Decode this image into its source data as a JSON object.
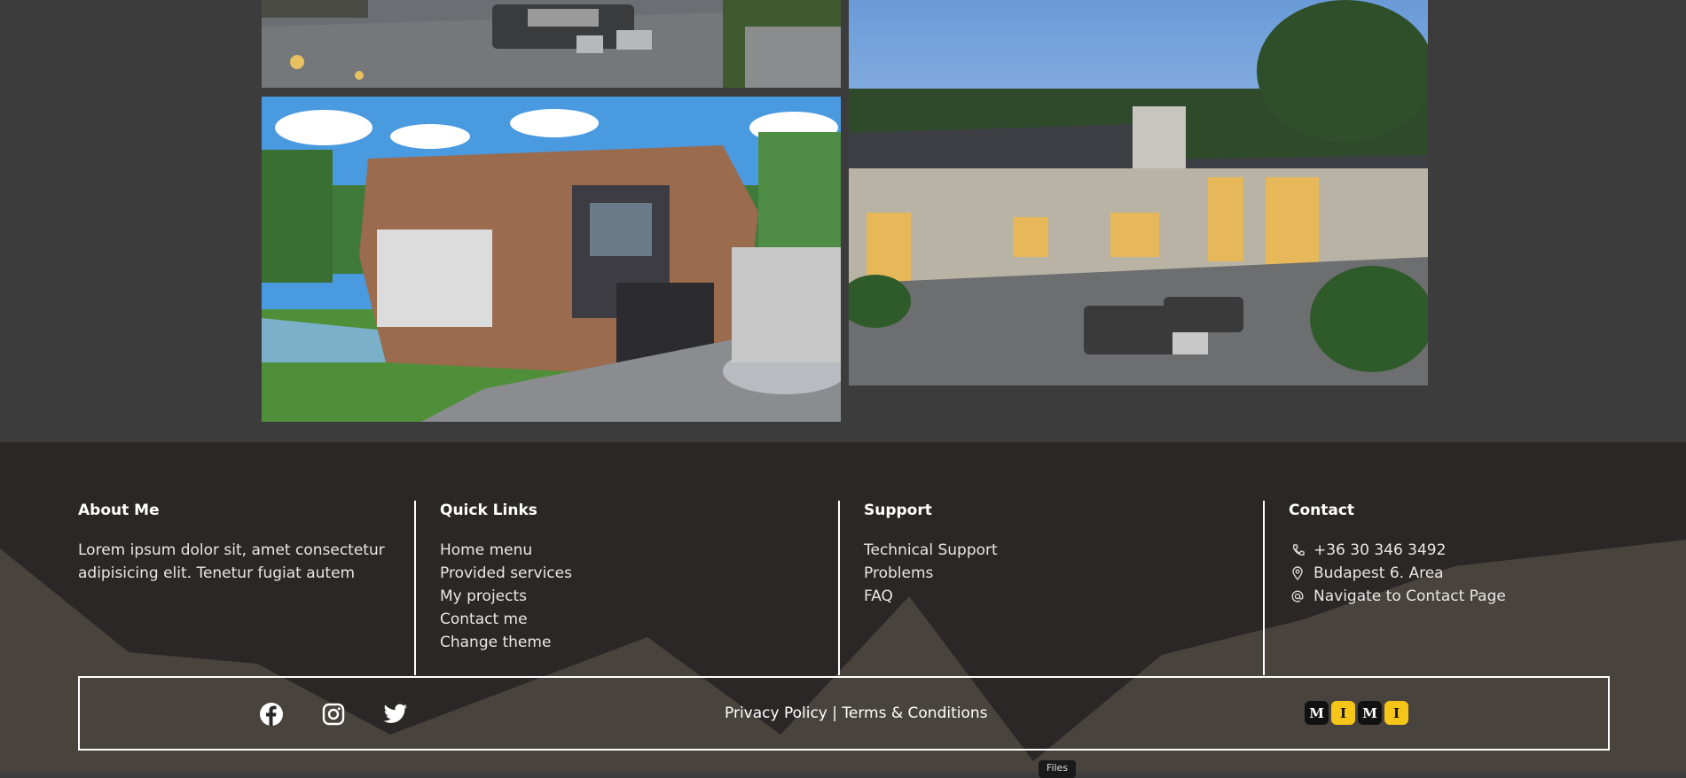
{
  "footer": {
    "about": {
      "heading": "About Me",
      "text_line1": "Lorem ipsum dolor sit, amet consectetur",
      "text_line2": "adipisicing elit. Tenetur fugiat autem"
    },
    "quick_links": {
      "heading": "Quick Links",
      "items": [
        "Home menu",
        "Provided services",
        "My projects",
        "Contact me",
        "Change theme"
      ]
    },
    "support": {
      "heading": "Support",
      "items": [
        "Technical Support",
        "Problems",
        "FAQ"
      ]
    },
    "contact": {
      "heading": "Contact",
      "phone": "+36 30 346 3492",
      "address": "Budapest 6. Area",
      "navigate": "Navigate to Contact Page",
      "icons": [
        "phone-icon",
        "location-pin-icon",
        "at-sign-icon"
      ]
    },
    "bottom": {
      "social_icons": [
        "facebook-icon",
        "instagram-icon",
        "twitter-icon"
      ],
      "privacy": "Privacy Policy",
      "separator": "|",
      "terms": "Terms & Conditions",
      "logo_letters": [
        "M",
        "I",
        "M",
        "I"
      ]
    }
  },
  "tooltip": "Files",
  "colors": {
    "page_bg": "#3c3c3c",
    "footer_bg": "#2b2726",
    "mountain": "#48433d",
    "logo_yellow": "#f5c518",
    "logo_black": "#111111"
  }
}
